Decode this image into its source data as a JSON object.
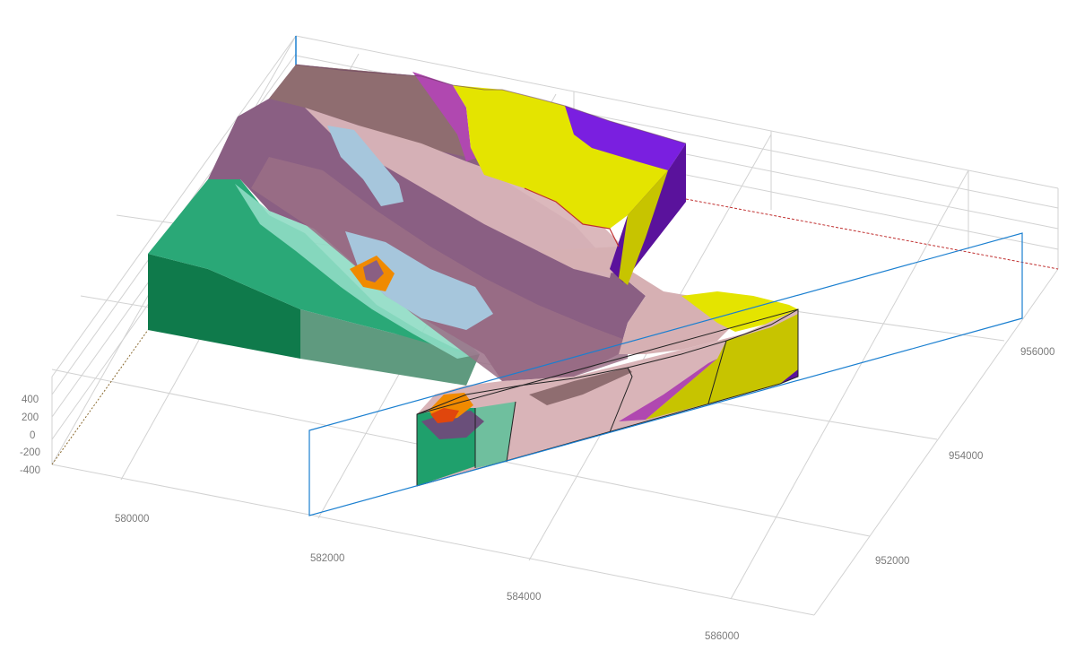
{
  "axes": {
    "z_ticks": [
      "400",
      "200",
      "0",
      "-200",
      "-400"
    ],
    "x_ticks": [
      "580000",
      "582000",
      "584000",
      "586000"
    ],
    "y_ticks": [
      "956000",
      "954000",
      "952000"
    ]
  },
  "colors": {
    "dark_green": "#0f7a4b",
    "green": "#22a872",
    "light_green": "#8fdcc4",
    "mauve": "#8a5f83",
    "brown": "#8f6d70",
    "pink": "#d9b4b8",
    "light_blue": "#a6c6dc",
    "orange": "#f08a00",
    "red_orange": "#e0460d",
    "magenta": "#b048b0",
    "yellow": "#e4e400",
    "olive_yellow": "#c7c400",
    "purple": "#7a1fe0",
    "dark_purple": "#5a129c",
    "section_frame": "#1a7fd0",
    "trace": "#c03030"
  }
}
